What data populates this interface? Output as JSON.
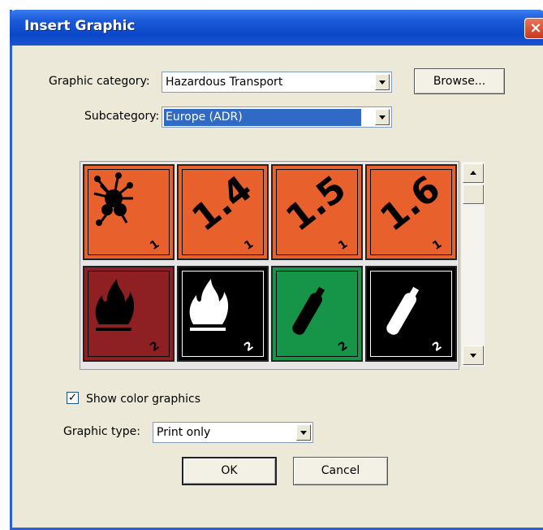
{
  "window": {
    "title": "Insert Graphic",
    "close_glyph": "×"
  },
  "form": {
    "category_label": "Graphic category:",
    "category_value": "Hazardous Transport",
    "browse_label": "Browse...",
    "subcategory_label": "Subcategory:",
    "subcategory_value": "Europe (ADR)",
    "show_color_label": "Show color graphics",
    "show_color_checked": true,
    "graphic_type_label": "Graphic type:",
    "graphic_type_value": "Print only",
    "ok_label": "OK",
    "cancel_label": "Cancel"
  },
  "tiles": [
    {
      "id": "explosive",
      "label": "",
      "class_no": "1",
      "bg": "#e8602c",
      "fg": "#000000"
    },
    {
      "id": "1.4",
      "label": "1.4",
      "class_no": "1",
      "bg": "#e8602c",
      "fg": "#000000"
    },
    {
      "id": "1.5",
      "label": "1.5",
      "class_no": "1",
      "bg": "#e8602c",
      "fg": "#000000"
    },
    {
      "id": "1.6",
      "label": "1.6",
      "class_no": "1",
      "bg": "#e8602c",
      "fg": "#000000"
    },
    {
      "id": "flammable-gas",
      "label": "",
      "class_no": "2",
      "bg": "#8e1f22",
      "fg": "#000000"
    },
    {
      "id": "flammable-gas-white",
      "label": "",
      "class_no": "2",
      "bg": "#000000",
      "fg": "#ffffff"
    },
    {
      "id": "non-flammable-gas",
      "label": "",
      "class_no": "2",
      "bg": "#169448",
      "fg": "#000000"
    },
    {
      "id": "gas-cylinder-white",
      "label": "",
      "class_no": "2",
      "bg": "#000000",
      "fg": "#ffffff"
    }
  ]
}
